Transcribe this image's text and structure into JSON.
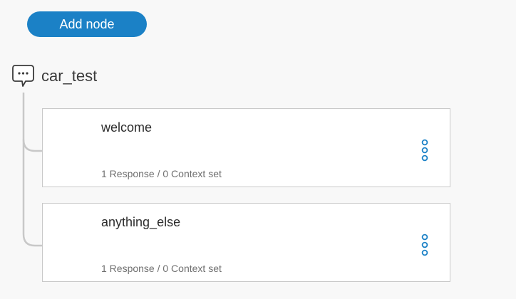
{
  "toolbar": {
    "add_node_label": "Add node"
  },
  "skill": {
    "icon": "chat-bubble-icon",
    "title": "car_test"
  },
  "nodes": [
    {
      "title": "welcome",
      "meta": "1 Response / 0 Context set",
      "menu_icon": "overflow-menu-vertical-icon"
    },
    {
      "title": "anything_else",
      "meta": "1 Response / 0 Context set",
      "menu_icon": "overflow-menu-vertical-icon"
    }
  ],
  "colors": {
    "accent": "#1b81c6",
    "background": "#f8f8f8",
    "card_border": "#c9c9c9",
    "tree_line": "#c8c8c8"
  }
}
